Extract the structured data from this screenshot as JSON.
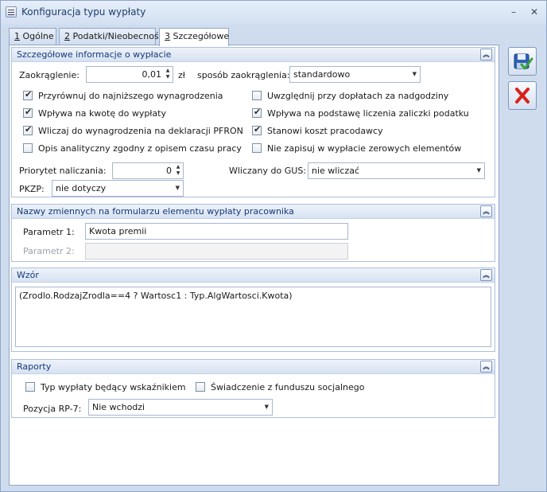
{
  "window": {
    "title": "Konfiguracja typu wypłaty",
    "minimize_glyph": "–",
    "close_glyph": "✕"
  },
  "tabs": [
    {
      "key": "1",
      "label": " Ogólne",
      "active": false
    },
    {
      "key": "2",
      "label": " Podatki/Nieobecności",
      "active": false
    },
    {
      "key": "3",
      "label": " Szczegółowe",
      "active": true
    }
  ],
  "details": {
    "title": "Szczegółowe informacje o wypłacie",
    "rounding_label": "Zaokrąglenie:",
    "rounding_value": "0,01",
    "rounding_unit": "zł",
    "rounding_method_label": "sposób zaokrąglenia:",
    "rounding_method_value": "standardowo",
    "checkboxes_left": [
      {
        "label": "Przyrównuj do najniższego wynagrodzenia",
        "checked": true
      },
      {
        "label": "Wpływa na kwotę do wypłaty",
        "checked": true
      },
      {
        "label": "Wliczaj do wynagrodzenia na deklaracji PFRON",
        "checked": true
      },
      {
        "label": "Opis analityczny zgodny z opisem czasu pracy",
        "checked": false
      }
    ],
    "checkboxes_right": [
      {
        "label": "Uwzględnij przy dopłatach za nadgodziny",
        "checked": false
      },
      {
        "label": "Wpływa na podstawę liczenia zaliczki podatku",
        "checked": true
      },
      {
        "label": "Stanowi koszt pracodawcy",
        "checked": true
      },
      {
        "label": "Nie zapisuj w wypłacie zerowych elementów",
        "checked": false
      }
    ],
    "priority_label": "Priorytet naliczania:",
    "priority_value": "0",
    "gus_label": "Wliczany do GUS:",
    "gus_value": "nie wliczać",
    "pkzp_label": "PKZP:",
    "pkzp_value": "nie dotyczy"
  },
  "variables": {
    "title": "Nazwy zmiennych na formularzu elementu wypłaty pracownika",
    "param1_label": "Parametr 1:",
    "param1_value": "Kwota premii",
    "param2_label": "Parametr 2:",
    "param2_value": ""
  },
  "formula": {
    "title": "Wzór",
    "text": "(Zrodlo.RodzajZrodla==4 ? Wartosc1 : Typ.AlgWartosci.Kwota)"
  },
  "reports": {
    "title": "Raporty",
    "indicator_label": "Typ wypłaty będący wskaźnikiem",
    "indicator_checked": false,
    "social_fund_label": "Świadczenie z funduszu socjalnego",
    "social_fund_checked": false,
    "rp7_label": "Pozycja RP-7:",
    "rp7_value": "Nie wchodzi"
  },
  "icons": {
    "collapse": "double-chevron-up-icon",
    "save": "save-check-icon",
    "cancel": "red-x-icon"
  },
  "colors": {
    "accent": "#15397a",
    "cancel_red": "#d9221b",
    "save_blue": "#2d62b5",
    "check_green": "#3aa33a"
  }
}
